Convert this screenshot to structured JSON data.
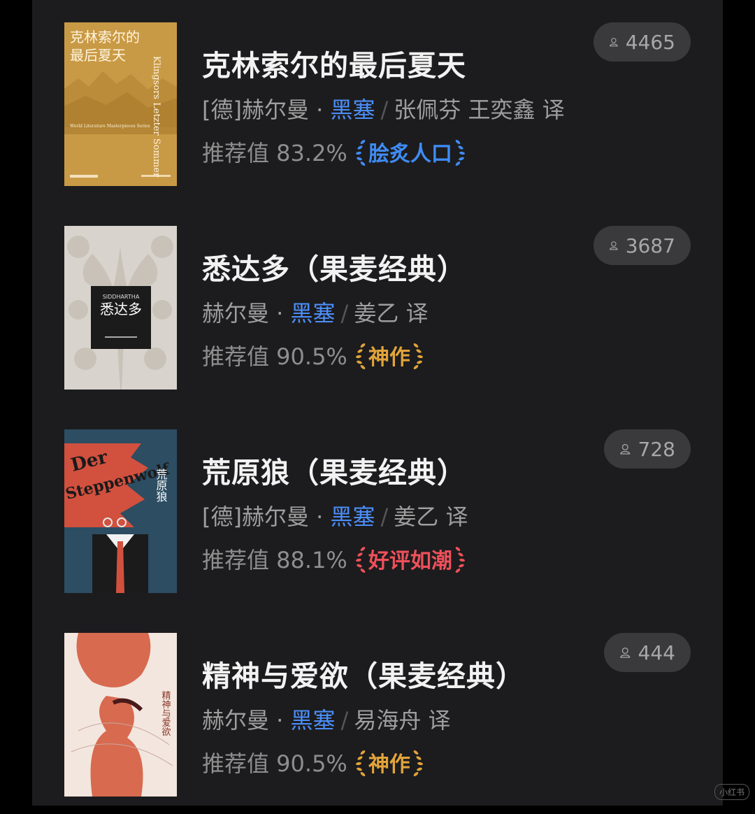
{
  "books": [
    {
      "title": "克林索尔的最后夏天",
      "author_prefix": "[德]赫尔曼 · ",
      "author_highlight": "黑塞",
      "translator": "张佩芬 王奕鑫 译",
      "rec_label": "推荐值 83.2%",
      "badge": "脍炙人口",
      "badge_color": "#3f8cf5",
      "readers": "4465",
      "cover": {
        "bg": "#c99a45",
        "title_line1": "克林索尔的",
        "title_line2": "最后夏天",
        "subtitle": "Klingsors Letzter Sommer",
        "series": "World Literature Masterpieces Series"
      }
    },
    {
      "title": "悉达多（果麦经典）",
      "author_prefix": "赫尔曼 · ",
      "author_highlight": "黑塞",
      "translator": "姜乙 译",
      "rec_label": "推荐值 90.5%",
      "badge": "神作",
      "badge_color": "#e2a43a",
      "readers": "3687",
      "cover": {
        "bg": "#d8d4cd",
        "label_en": "SIDDHARTHA",
        "label_cn": "悉达多"
      }
    },
    {
      "title": "荒原狼（果麦经典）",
      "author_prefix": "[德]赫尔曼 · ",
      "author_highlight": "黑塞",
      "translator": "姜乙 译",
      "rec_label": "推荐值 88.1%",
      "badge": "好评如潮",
      "badge_color": "#f0505a",
      "readers": "728",
      "cover": {
        "bg": "#2c4d62",
        "label_en1": "Der",
        "label_en2": "Steppenwolf",
        "label_cn": "荒原狼"
      }
    },
    {
      "title": "精神与爱欲（果麦经典）",
      "author_prefix": "赫尔曼 · ",
      "author_highlight": "黑塞",
      "translator": "易海舟 译",
      "rec_label": "推荐值 90.5%",
      "badge": "神作",
      "badge_color": "#e2a43a",
      "readers": "444",
      "cover": {
        "bg": "#f3e6de",
        "label_cn": "精神与爱欲"
      }
    }
  ],
  "watermark": "小红书"
}
